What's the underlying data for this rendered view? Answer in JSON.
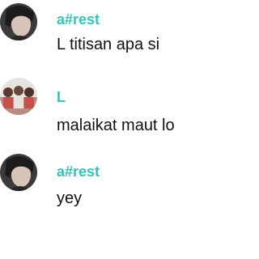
{
  "comments": [
    {
      "username": "a#rest",
      "text": "L titisan apa si",
      "avatar": "person-portrait-avatar"
    },
    {
      "username": "L",
      "text": "malaikat maut lo",
      "avatar": "group-photo-avatar"
    },
    {
      "username": "a#rest",
      "text": "yey",
      "avatar": "person-portrait-avatar"
    }
  ],
  "colors": {
    "username": "#33c5b8",
    "text": "#111111",
    "background": "#ffffff"
  }
}
